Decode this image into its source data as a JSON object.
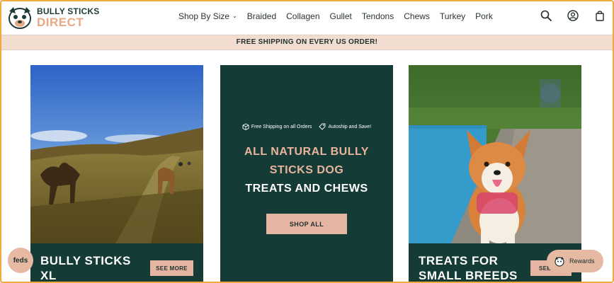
{
  "brand": {
    "line1": "BULLY STICKS",
    "line2": "DIRECT"
  },
  "nav": [
    {
      "label": "Shop By Size",
      "dropdown": true
    },
    {
      "label": "Braided"
    },
    {
      "label": "Collagen"
    },
    {
      "label": "Gullet"
    },
    {
      "label": "Tendons"
    },
    {
      "label": "Chews"
    },
    {
      "label": "Turkey"
    },
    {
      "label": "Pork"
    }
  ],
  "header_icons": [
    "search-icon",
    "account-icon",
    "cart-icon"
  ],
  "announcement": "FREE SHIPPING ON EVERY US ORDER!",
  "cards": {
    "left": {
      "title": "BULLY STICKS XL",
      "button": "SEE MORE"
    },
    "middle": {
      "badge1": "Free Shipping on all Orders",
      "badge2": "Autoship and Save!",
      "heading_accent": "ALL NATURAL BULLY STICKS DOG",
      "heading_white": "TREATS AND CHEWS",
      "button": "SHOP ALL"
    },
    "right": {
      "title": "TREATS FOR SMALL BREEDS",
      "button": "SEE A"
    }
  },
  "widgets": {
    "feds": "feds",
    "rewards": "Rewards"
  },
  "colors": {
    "accent": "#e5b5a1",
    "dark_teal": "#153b37",
    "announce_bg": "#f1ded1",
    "frame": "#f2a93b"
  }
}
